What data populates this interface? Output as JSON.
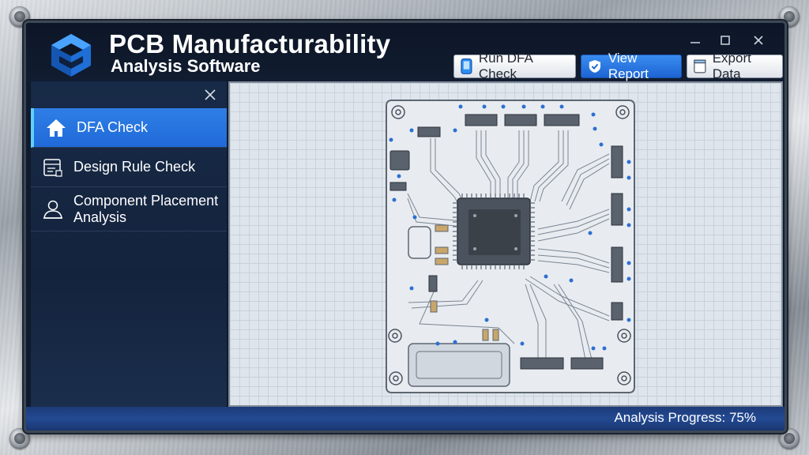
{
  "app": {
    "title": "PCB Manufacturability",
    "subtitle": "Analysis Software"
  },
  "toolbar": {
    "run_label": "Run DFA Check",
    "report_label": "View Report",
    "export_label": "Export Data"
  },
  "sidebar": {
    "items": [
      {
        "label": "DFA Check",
        "icon": "home-icon",
        "active": true
      },
      {
        "label": "Design Rule Check",
        "icon": "checklist-icon",
        "active": false
      },
      {
        "label": "Component Placement Analysis",
        "icon": "user-icon",
        "active": false
      }
    ]
  },
  "status": {
    "progress_text": "Analysis Progress: 75%",
    "progress_value": 0.75
  },
  "colors": {
    "accent": "#1f6ad8",
    "active_border": "#5fd0ff",
    "status_bar": "#1c3a78"
  }
}
